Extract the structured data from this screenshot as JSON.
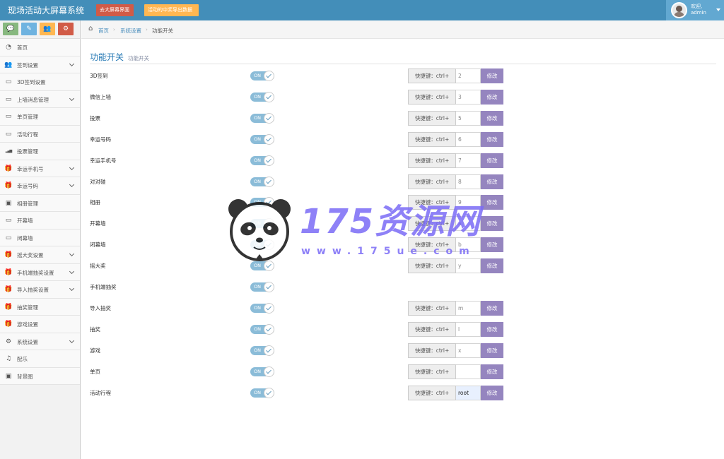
{
  "navbar": {
    "brand": "现场活动大屏幕系统",
    "btn_bigscreen": "去大屏幕界面",
    "btn_export": "活动的中奖导出数据",
    "welcome": "欢迎,",
    "username": "admin"
  },
  "sidebar": {
    "shortcuts": [
      {
        "icon": "comment-icon",
        "glyph": "💬",
        "color": "#87b87f"
      },
      {
        "icon": "pencil-icon",
        "glyph": "✎",
        "color": "#6fb3e0"
      },
      {
        "icon": "users-icon",
        "glyph": "👥",
        "color": "#ffb752"
      },
      {
        "icon": "cogs-icon",
        "glyph": "⚙",
        "color": "#d15b47"
      }
    ],
    "items": [
      {
        "label": "首页",
        "icon": "dashboard-icon",
        "glyph": "◔",
        "arrow": false
      },
      {
        "label": "签到设置",
        "icon": "users-icon",
        "glyph": "👥",
        "arrow": true
      },
      {
        "label": "3D签到设置",
        "icon": "desktop-icon",
        "glyph": "▭",
        "arrow": false
      },
      {
        "label": "上墙消息管理",
        "icon": "desktop-icon",
        "glyph": "▭",
        "arrow": true
      },
      {
        "label": "单页管理",
        "icon": "desktop-icon",
        "glyph": "▭",
        "arrow": false
      },
      {
        "label": "活动行程",
        "icon": "desktop-icon",
        "glyph": "▭",
        "arrow": false
      },
      {
        "label": "投票管理",
        "icon": "signal-icon",
        "glyph": "▂▄▆",
        "arrow": false
      },
      {
        "label": "幸运手机号",
        "icon": "gift-icon",
        "glyph": "🎁",
        "arrow": true
      },
      {
        "label": "幸运号码",
        "icon": "gift-icon",
        "glyph": "🎁",
        "arrow": true
      },
      {
        "label": "相册管理",
        "icon": "picture-icon",
        "glyph": "▣",
        "arrow": false
      },
      {
        "label": "开幕墙",
        "icon": "desktop-icon",
        "glyph": "▭",
        "arrow": false
      },
      {
        "label": "闭幕墙",
        "icon": "desktop-icon",
        "glyph": "▭",
        "arrow": false
      },
      {
        "label": "摇大奖设置",
        "icon": "gift-icon",
        "glyph": "🎁",
        "arrow": true
      },
      {
        "label": "手机端抽奖设置",
        "icon": "gift-icon",
        "glyph": "🎁",
        "arrow": true
      },
      {
        "label": "导入抽奖设置",
        "icon": "gift-icon",
        "glyph": "🎁",
        "arrow": true
      },
      {
        "label": "抽奖管理",
        "icon": "gift-icon",
        "glyph": "🎁",
        "arrow": false
      },
      {
        "label": "游戏设置",
        "icon": "gift-icon",
        "glyph": "🎁",
        "arrow": false
      },
      {
        "label": "系统设置",
        "icon": "gear-icon",
        "glyph": "⚙",
        "arrow": true
      },
      {
        "label": "配乐",
        "icon": "music-icon",
        "glyph": "♫",
        "arrow": false
      },
      {
        "label": "背景图",
        "icon": "picture-icon",
        "glyph": "▣",
        "arrow": false
      }
    ]
  },
  "breadcrumb": {
    "home": "首页",
    "section": "系统设置",
    "current": "功能开关"
  },
  "page": {
    "title": "功能开关",
    "subtitle": "功能开关"
  },
  "hotkey_prefix": "快捷键：ctrl+",
  "modify_label": "修改",
  "toggle_on": "ON",
  "rows": [
    {
      "label": "3D签到",
      "on": true,
      "hotkey": "2",
      "has_hotkey": true
    },
    {
      "label": "微信上墙",
      "on": true,
      "hotkey": "3",
      "has_hotkey": true
    },
    {
      "label": "投票",
      "on": true,
      "hotkey": "5",
      "has_hotkey": true
    },
    {
      "label": "幸运号码",
      "on": true,
      "hotkey": "6",
      "has_hotkey": true
    },
    {
      "label": "幸运手机号",
      "on": true,
      "hotkey": "7",
      "has_hotkey": true
    },
    {
      "label": "对对碰",
      "on": true,
      "hotkey": "8",
      "has_hotkey": true
    },
    {
      "label": "相册",
      "on": true,
      "hotkey": "9",
      "has_hotkey": true
    },
    {
      "label": "开幕墙",
      "on": true,
      "hotkey": "a",
      "has_hotkey": true
    },
    {
      "label": "闭幕墙",
      "on": true,
      "hotkey": "b",
      "has_hotkey": true
    },
    {
      "label": "摇大奖",
      "on": true,
      "hotkey": "y",
      "has_hotkey": true
    },
    {
      "label": "手机端抽奖",
      "on": true,
      "hotkey": "",
      "has_hotkey": false
    },
    {
      "label": "导入抽奖",
      "on": true,
      "hotkey": "m",
      "has_hotkey": true
    },
    {
      "label": "抽奖",
      "on": true,
      "hotkey": "l",
      "has_hotkey": true
    },
    {
      "label": "游戏",
      "on": true,
      "hotkey": "x",
      "has_hotkey": true
    },
    {
      "label": "单页",
      "on": true,
      "hotkey": "",
      "has_hotkey": true
    },
    {
      "label": "活动行程",
      "on": true,
      "hotkey": "root",
      "has_hotkey": true,
      "filled": true
    }
  ],
  "watermark": {
    "big": "175资源网",
    "small": "www.175ue.com"
  }
}
